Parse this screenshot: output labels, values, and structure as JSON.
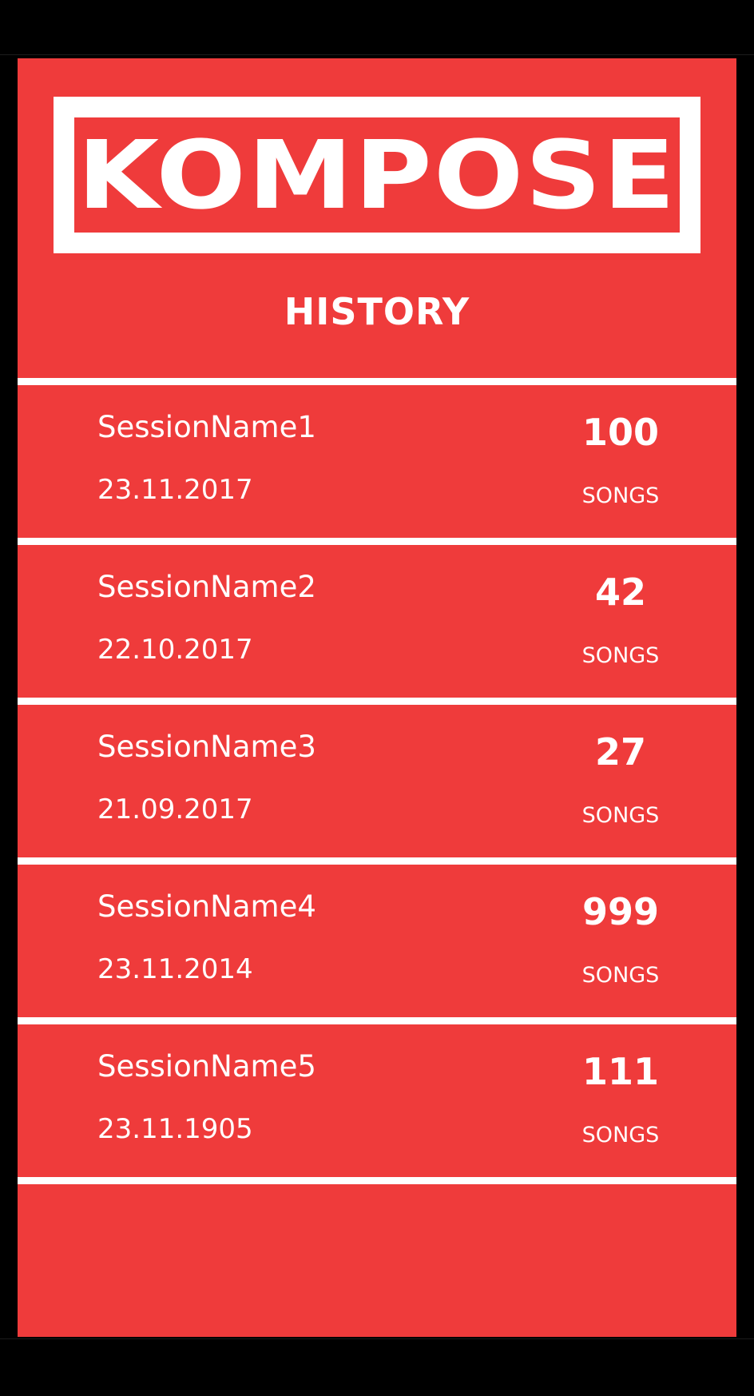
{
  "app": {
    "logo_text": "KOMPOSE"
  },
  "header": {
    "title": "HISTORY"
  },
  "sessions": [
    {
      "name": "SessionName1",
      "date": "23.11.2017",
      "count": "100",
      "unit": "SONGS"
    },
    {
      "name": "SessionName2",
      "date": "22.10.2017",
      "count": "42",
      "unit": "SONGS"
    },
    {
      "name": "SessionName3",
      "date": "21.09.2017",
      "count": "27",
      "unit": "SONGS"
    },
    {
      "name": "SessionName4",
      "date": "23.11.2014",
      "count": "999",
      "unit": "SONGS"
    },
    {
      "name": "SessionName5",
      "date": "23.11.1905",
      "count": "111",
      "unit": "SONGS"
    }
  ],
  "theme": {
    "background": "#ef3b3b",
    "foreground": "#ffffff",
    "bezel": "#000000"
  }
}
